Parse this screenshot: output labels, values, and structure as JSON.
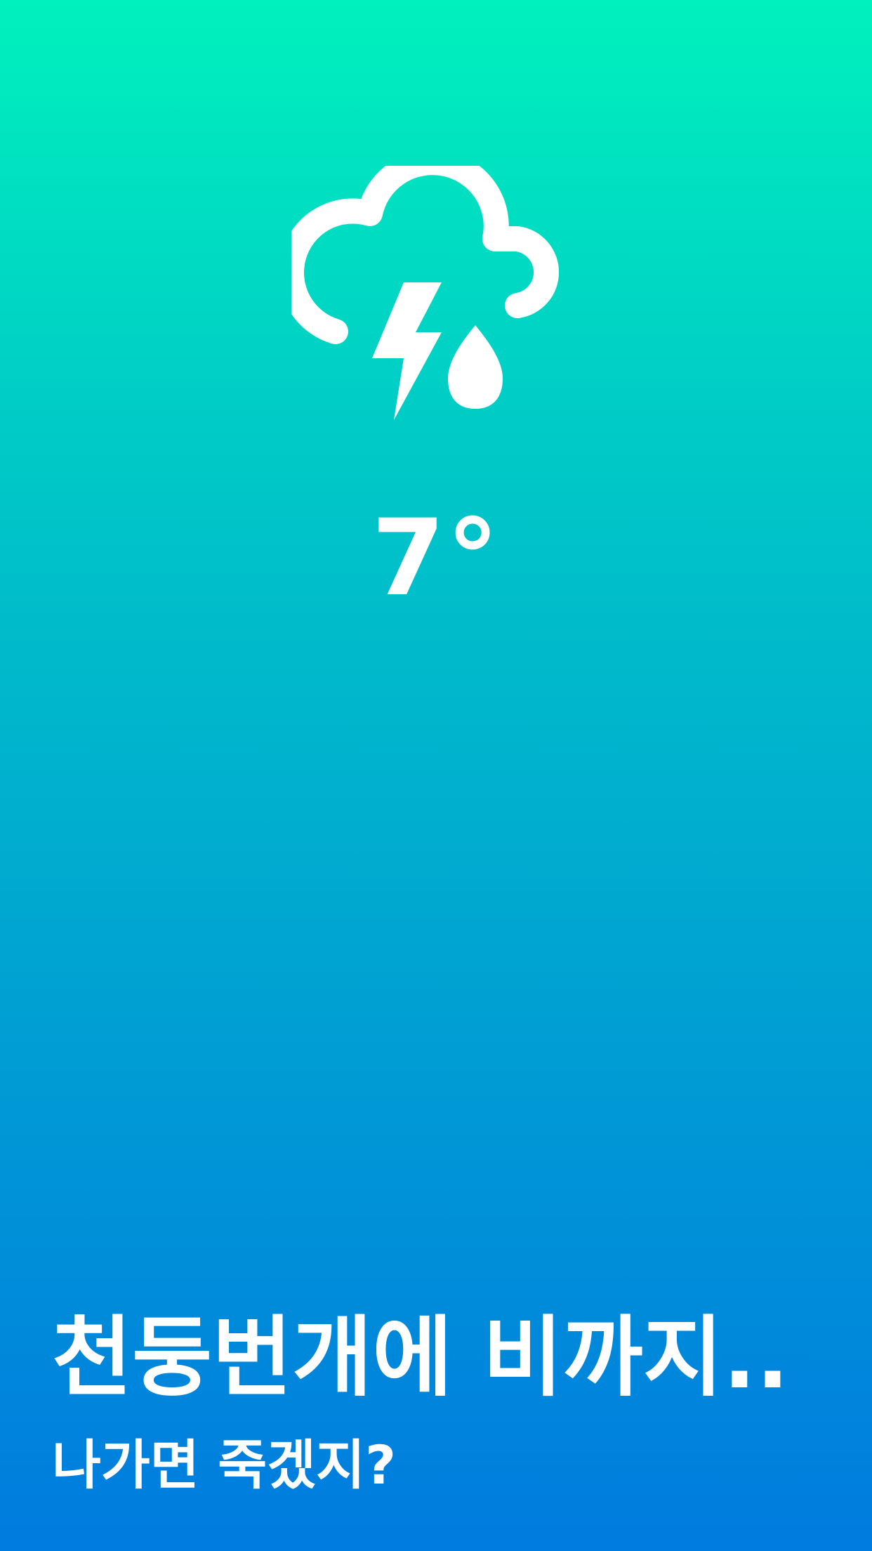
{
  "weather": {
    "icon": "cloud-lightning-rain-icon",
    "temperature": "7°"
  },
  "message": {
    "headline": "천둥번개에 비까지..",
    "subline": "나가면 죽겠지?"
  },
  "colors": {
    "background_top": "#00f1bd",
    "background_bottom": "#007bdf",
    "foreground": "#ffffff"
  }
}
